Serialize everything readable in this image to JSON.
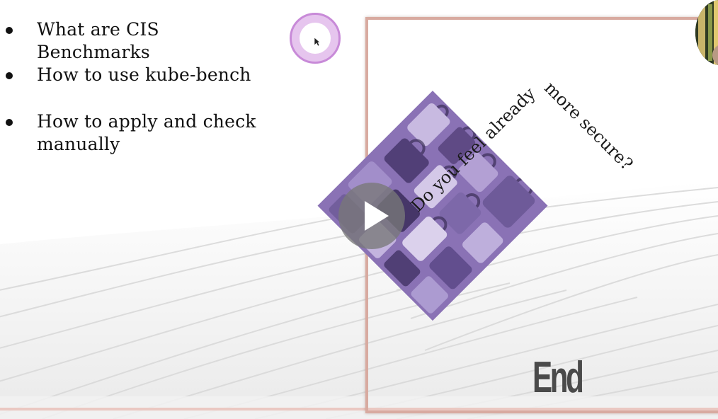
{
  "slide": {
    "bullets": [
      "What are CIS Benchmarks",
      "How to use kube-bench",
      "How to apply and check manually"
    ]
  },
  "preview": {
    "tilted_text_left": "Do you feel already",
    "tilted_text_right": "more secure?",
    "end_label": "End",
    "image_subject": "padlocks-photo",
    "image_tint": "#9b84c4"
  },
  "player": {
    "play_icon": "play-icon"
  },
  "colors": {
    "cursor_ring": "#c88ad8",
    "frame_border": "#d8aaa0",
    "text": "#111111"
  }
}
